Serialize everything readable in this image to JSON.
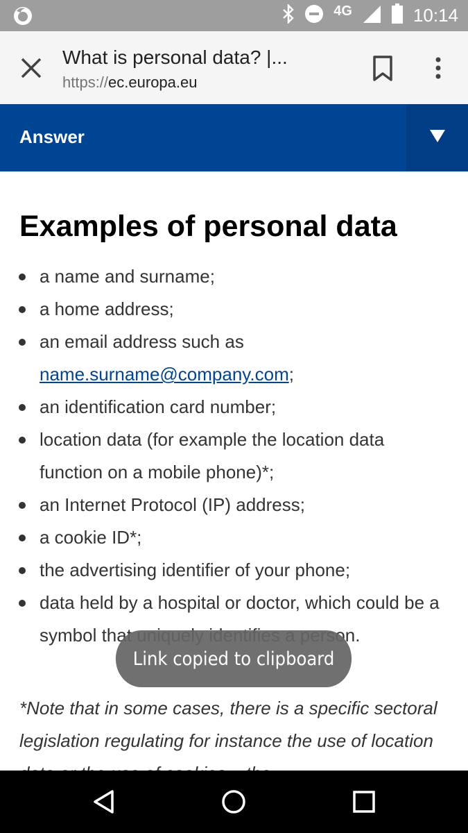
{
  "status_bar": {
    "network": "4G",
    "time": "10:14",
    "icons": [
      "firefox-icon",
      "bluetooth-icon",
      "do-not-disturb-icon",
      "signal-icon",
      "battery-icon"
    ]
  },
  "toolbar": {
    "title": "What is personal data? |...",
    "url_scheme": "https://",
    "url_host": "ec.europa.eu"
  },
  "answer_bar": {
    "label": "Answer"
  },
  "content": {
    "heading": "Examples of personal data",
    "items": [
      "a name and surname;",
      "a home address;",
      "an email address such as",
      "an identification card number;",
      "location data (for example the location data function on a mobile phone)*;",
      "an Internet Protocol (IP) address;",
      "a cookie ID*;",
      "the advertising identifier of your phone;",
      "data held by a hospital or doctor, which could be a symbol that uniquely identifies a person."
    ],
    "email_link": "name.surname@company.com",
    "email_suffix": ";",
    "note": "*Note that in some cases, there is a specific sectoral legislation regulating for instance the use of location data or the use of cookies – the"
  },
  "toast": {
    "message": "Link copied to clipboard"
  },
  "colors": {
    "status_bar": "#9e9e9e",
    "answer_bar": "#004494",
    "link": "#004494"
  }
}
